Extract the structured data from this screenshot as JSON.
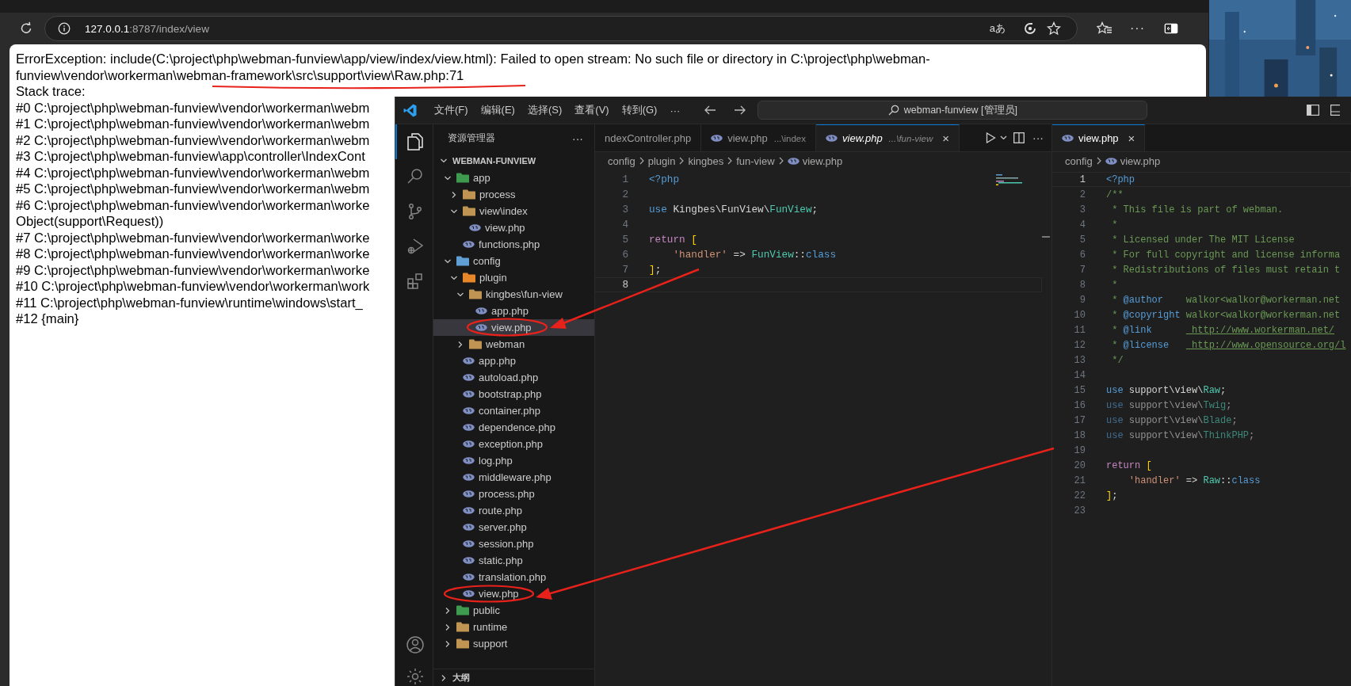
{
  "browser": {
    "address": {
      "host": "127.0.0.1",
      "path": ":8787/index/view"
    },
    "read_aloud": "aあ",
    "more": "···"
  },
  "error_page": {
    "message": "ErrorException: include(C:\\project\\php\\webman-funview\\app/view/index/view.html): Failed to open stream: No such file or directory in C:\\project\\php\\webman-funview\\vendor\\workerman\\webman-framework\\src\\support\\view\\Raw.php:71",
    "trace_heading": "Stack trace:",
    "trace": [
      "#0 C:\\project\\php\\webman-funview\\vendor\\workerman\\webm",
      "#1 C:\\project\\php\\webman-funview\\vendor\\workerman\\webm",
      "#2 C:\\project\\php\\webman-funview\\vendor\\workerman\\webm",
      "#3 C:\\project\\php\\webman-funview\\app\\controller\\IndexCont",
      "#4 C:\\project\\php\\webman-funview\\vendor\\workerman\\webm",
      "#5 C:\\project\\php\\webman-funview\\vendor\\workerman\\webm",
      "#6 C:\\project\\php\\webman-funview\\vendor\\workerman\\worke",
      "Object(support\\Request))",
      "#7 C:\\project\\php\\webman-funview\\vendor\\workerman\\worke",
      "#8 C:\\project\\php\\webman-funview\\vendor\\workerman\\worke",
      "#9 C:\\project\\php\\webman-funview\\vendor\\workerman\\worke",
      "#10 C:\\project\\php\\webman-funview\\vendor\\workerman\\work",
      "#11 C:\\project\\php\\webman-funview\\runtime\\windows\\start_",
      "#12 {main}"
    ]
  },
  "vscode": {
    "menu": [
      "文件(F)",
      "编辑(E)",
      "选择(S)",
      "查看(V)",
      "转到(G)",
      "···"
    ],
    "command_center": "webman-funview [管理员]",
    "activity_bar": [
      {
        "kind": "explorer",
        "selected": true
      },
      {
        "kind": "search",
        "selected": false
      },
      {
        "kind": "source-control",
        "selected": false
      },
      {
        "kind": "run",
        "selected": false
      },
      {
        "kind": "extensions",
        "selected": false
      }
    ],
    "activity_bar_bottom": [
      {
        "kind": "account"
      },
      {
        "kind": "settings"
      }
    ],
    "explorer": {
      "title": "资源管理器",
      "more": "···",
      "root": "WEBMAN-FUNVIEW",
      "tree": [
        {
          "name": "app",
          "kind": "folder",
          "color": "#3d9a4f",
          "expanded": true,
          "selected": false,
          "children": [
            {
              "name": "process",
              "kind": "folder",
              "color": "#c09553",
              "expanded": false,
              "selected": false
            },
            {
              "name": "view\\index",
              "kind": "folder",
              "color": "#c09553",
              "expanded": true,
              "selected": false,
              "children": [
                {
                  "name": "view.php",
                  "kind": "file",
                  "selected": false
                }
              ]
            },
            {
              "name": "functions.php",
              "kind": "file",
              "selected": false
            }
          ]
        },
        {
          "name": "config",
          "kind": "folder",
          "color": "#5f9fd6",
          "expanded": true,
          "selected": false,
          "children": [
            {
              "name": "plugin",
              "kind": "folder",
              "color": "#e8862a",
              "expanded": true,
              "selected": false,
              "children": [
                {
                  "name": "kingbes\\fun-view",
                  "kind": "folder",
                  "color": "#c09553",
                  "expanded": true,
                  "selected": false,
                  "children": [
                    {
                      "name": "app.php",
                      "kind": "file",
                      "selected": false
                    },
                    {
                      "name": "view.php",
                      "kind": "file",
                      "selected": true
                    }
                  ]
                },
                {
                  "name": "webman",
                  "kind": "folder",
                  "color": "#c09553",
                  "expanded": false,
                  "selected": false
                }
              ]
            },
            {
              "name": "app.php",
              "kind": "file",
              "selected": false
            },
            {
              "name": "autoload.php",
              "kind": "file",
              "selected": false
            },
            {
              "name": "bootstrap.php",
              "kind": "file",
              "selected": false
            },
            {
              "name": "container.php",
              "kind": "file",
              "selected": false
            },
            {
              "name": "dependence.php",
              "kind": "file",
              "selected": false
            },
            {
              "name": "exception.php",
              "kind": "file",
              "selected": false
            },
            {
              "name": "log.php",
              "kind": "file",
              "selected": false
            },
            {
              "name": "middleware.php",
              "kind": "file",
              "selected": false
            },
            {
              "name": "process.php",
              "kind": "file",
              "selected": false
            },
            {
              "name": "route.php",
              "kind": "file",
              "selected": false
            },
            {
              "name": "server.php",
              "kind": "file",
              "selected": false
            },
            {
              "name": "session.php",
              "kind": "file",
              "selected": false
            },
            {
              "name": "static.php",
              "kind": "file",
              "selected": false
            },
            {
              "name": "translation.php",
              "kind": "file",
              "selected": false
            },
            {
              "name": "view.php",
              "kind": "file",
              "selected": false
            }
          ]
        },
        {
          "name": "public",
          "kind": "folder",
          "color": "#3d9a4f",
          "expanded": false,
          "selected": false
        },
        {
          "name": "runtime",
          "kind": "folder",
          "color": "#c09553",
          "expanded": false,
          "selected": false
        },
        {
          "name": "support",
          "kind": "folder",
          "color": "#c09553",
          "expanded": false,
          "selected": false
        }
      ],
      "outline": "大纲"
    },
    "editor_groups": [
      {
        "tabs": [
          {
            "label": "ndexController.php",
            "icon": false,
            "selected": false,
            "preview": false
          },
          {
            "label": "view.php",
            "detail": "...\\index",
            "icon": true,
            "selected": false,
            "preview": false
          },
          {
            "label": "view.php",
            "detail": "...\\fun-view",
            "icon": true,
            "selected": true,
            "preview": true,
            "close": "×"
          }
        ],
        "actions_more": "···",
        "minimap": true,
        "breadcrumb": [
          "config",
          "plugin",
          "kingbes",
          "fun-view",
          "view.php"
        ],
        "lines": [
          {
            "number": "1",
            "current": false,
            "tokens": [
              {
                "text": "<?php",
                "kind": "tag"
              }
            ]
          },
          {
            "number": "2",
            "current": false
          },
          {
            "number": "3",
            "current": false,
            "tokens": [
              {
                "text": "use",
                "kind": "kw"
              },
              {
                "text": " Kingbes\\FunView\\",
                "kind": "txt"
              },
              {
                "text": "FunView",
                "kind": "cls"
              },
              {
                "text": ";",
                "kind": "txt"
              }
            ]
          },
          {
            "number": "4",
            "current": false
          },
          {
            "number": "5",
            "current": false,
            "tokens": [
              {
                "text": "return",
                "kind": "ctl"
              },
              {
                "text": " [",
                "kind": "br"
              }
            ]
          },
          {
            "number": "6",
            "current": false,
            "tokens": [
              {
                "text": "    'handler'",
                "kind": "str"
              },
              {
                "text": " => ",
                "kind": "txt"
              },
              {
                "text": "FunView",
                "kind": "cls"
              },
              {
                "text": "::",
                "kind": "txt"
              },
              {
                "text": "class",
                "kind": "kw"
              }
            ]
          },
          {
            "number": "7",
            "current": false,
            "tokens": [
              {
                "text": "]",
                "kind": "br"
              },
              {
                "text": ";",
                "kind": "txt"
              }
            ]
          },
          {
            "number": "8",
            "current": true
          }
        ]
      },
      {
        "tabs": [
          {
            "label": "view.php",
            "icon": true,
            "selected": true,
            "preview": false,
            "close": "×"
          }
        ],
        "minimap": false,
        "breadcrumb": [
          "config",
          "view.php"
        ],
        "lines": [
          {
            "number": "1",
            "current": true,
            "tokens": [
              {
                "text": "<?php",
                "kind": "tag"
              }
            ]
          },
          {
            "number": "2",
            "current": false,
            "tokens": [
              {
                "text": "/**",
                "kind": "cm"
              }
            ]
          },
          {
            "number": "3",
            "current": false,
            "tokens": [
              {
                "text": " * This file is part of webman.",
                "kind": "cm"
              }
            ]
          },
          {
            "number": "4",
            "current": false,
            "tokens": [
              {
                "text": " *",
                "kind": "cm"
              }
            ]
          },
          {
            "number": "5",
            "current": false,
            "tokens": [
              {
                "text": " * Licensed under The MIT License",
                "kind": "cm"
              }
            ]
          },
          {
            "number": "6",
            "current": false,
            "tokens": [
              {
                "text": " * For full copyright and license informa",
                "kind": "cm"
              }
            ]
          },
          {
            "number": "7",
            "current": false,
            "tokens": [
              {
                "text": " * Redistributions of files must retain t",
                "kind": "cm"
              }
            ]
          },
          {
            "number": "8",
            "current": false,
            "tokens": [
              {
                "text": " *",
                "kind": "cm"
              }
            ]
          },
          {
            "number": "9",
            "current": false,
            "tokens": [
              {
                "text": " * ",
                "kind": "cm"
              },
              {
                "text": "@author",
                "kind": "doc"
              },
              {
                "text": "    walkor<walkor@workerman.net",
                "kind": "cm"
              }
            ]
          },
          {
            "number": "10",
            "current": false,
            "tokens": [
              {
                "text": " * ",
                "kind": "cm"
              },
              {
                "text": "@copyright",
                "kind": "doc"
              },
              {
                "text": " walkor<walkor@workerman.net",
                "kind": "cm"
              }
            ]
          },
          {
            "number": "11",
            "current": false,
            "tokens": [
              {
                "text": " * ",
                "kind": "cm"
              },
              {
                "text": "@link      ",
                "kind": "doc"
              },
              {
                "text": " http://www.workerman.net/",
                "kind": "link"
              }
            ]
          },
          {
            "number": "12",
            "current": false,
            "tokens": [
              {
                "text": " * ",
                "kind": "cm"
              },
              {
                "text": "@license   ",
                "kind": "doc"
              },
              {
                "text": " http://www.opensource.org/l",
                "kind": "link"
              }
            ]
          },
          {
            "number": "13",
            "current": false,
            "tokens": [
              {
                "text": " */",
                "kind": "cm"
              }
            ]
          },
          {
            "number": "14",
            "current": false
          },
          {
            "number": "15",
            "current": false,
            "tokens": [
              {
                "text": "use",
                "kind": "kw"
              },
              {
                "text": " support\\view\\",
                "kind": "txt"
              },
              {
                "text": "Raw",
                "kind": "cls"
              },
              {
                "text": ";",
                "kind": "txt"
              }
            ]
          },
          {
            "number": "16",
            "current": false,
            "faded": true,
            "tokens": [
              {
                "text": "use",
                "kind": "kw"
              },
              {
                "text": " support\\view\\",
                "kind": "txt"
              },
              {
                "text": "Twig",
                "kind": "cls"
              },
              {
                "text": ";",
                "kind": "txt"
              }
            ]
          },
          {
            "number": "17",
            "current": false,
            "faded": true,
            "tokens": [
              {
                "text": "use",
                "kind": "kw"
              },
              {
                "text": " support\\view\\",
                "kind": "txt"
              },
              {
                "text": "Blade",
                "kind": "cls"
              },
              {
                "text": ";",
                "kind": "txt"
              }
            ]
          },
          {
            "number": "18",
            "current": false,
            "faded": true,
            "tokens": [
              {
                "text": "use",
                "kind": "kw"
              },
              {
                "text": " support\\view\\",
                "kind": "txt"
              },
              {
                "text": "ThinkPHP",
                "kind": "cls"
              },
              {
                "text": ";",
                "kind": "txt"
              }
            ]
          },
          {
            "number": "19",
            "current": false
          },
          {
            "number": "20",
            "current": false,
            "tokens": [
              {
                "text": "return",
                "kind": "ctl"
              },
              {
                "text": " [",
                "kind": "br"
              }
            ]
          },
          {
            "number": "21",
            "current": false,
            "tokens": [
              {
                "text": "    'handler'",
                "kind": "str"
              },
              {
                "text": " => ",
                "kind": "txt"
              },
              {
                "text": "Raw",
                "kind": "cls"
              },
              {
                "text": "::",
                "kind": "txt"
              },
              {
                "text": "class",
                "kind": "kw"
              }
            ]
          },
          {
            "number": "22",
            "current": false,
            "tokens": [
              {
                "text": "]",
                "kind": "br"
              },
              {
                "text": ";",
                "kind": "txt"
              }
            ]
          },
          {
            "number": "23",
            "current": false
          }
        ]
      }
    ]
  }
}
